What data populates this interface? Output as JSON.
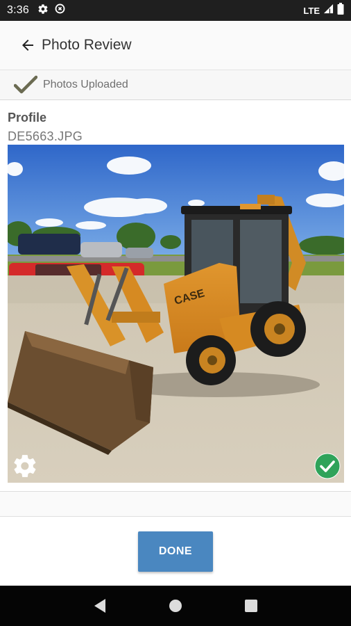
{
  "status_bar": {
    "time": "3:36",
    "network": "LTE",
    "icons": [
      "settings-icon",
      "data-saver-icon",
      "signal-icon",
      "battery-icon"
    ]
  },
  "toolbar": {
    "back_icon": "arrow-left-icon",
    "title": "Photo Review"
  },
  "upload_status": {
    "icon": "checkmark-icon",
    "text": "Photos Uploaded",
    "check_color": "#6b6b52"
  },
  "photo": {
    "label": "Profile",
    "filename": "DE5663.JPG",
    "image_description": "yellow CASE backhoe loader on gravel lot",
    "machine_brand": "CASE",
    "settings_icon": "gear-icon",
    "status_icon": "check-circle-icon",
    "status_color": "#2fa35a"
  },
  "footer": {
    "done_label": "DONE",
    "button_color": "#4a87c0"
  },
  "nav_bar": {
    "icons": [
      "back-triangle-icon",
      "home-circle-icon",
      "recents-square-icon"
    ]
  }
}
